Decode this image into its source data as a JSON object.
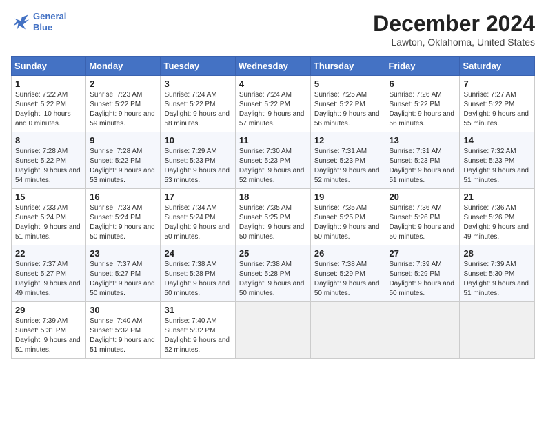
{
  "header": {
    "logo_line1": "General",
    "logo_line2": "Blue",
    "title": "December 2024",
    "subtitle": "Lawton, Oklahoma, United States"
  },
  "columns": [
    "Sunday",
    "Monday",
    "Tuesday",
    "Wednesday",
    "Thursday",
    "Friday",
    "Saturday"
  ],
  "weeks": [
    [
      {
        "day": "1",
        "sunrise": "7:22 AM",
        "sunset": "5:22 PM",
        "daylight": "10 hours and 0 minutes."
      },
      {
        "day": "2",
        "sunrise": "7:23 AM",
        "sunset": "5:22 PM",
        "daylight": "9 hours and 59 minutes."
      },
      {
        "day": "3",
        "sunrise": "7:24 AM",
        "sunset": "5:22 PM",
        "daylight": "9 hours and 58 minutes."
      },
      {
        "day": "4",
        "sunrise": "7:24 AM",
        "sunset": "5:22 PM",
        "daylight": "9 hours and 57 minutes."
      },
      {
        "day": "5",
        "sunrise": "7:25 AM",
        "sunset": "5:22 PM",
        "daylight": "9 hours and 56 minutes."
      },
      {
        "day": "6",
        "sunrise": "7:26 AM",
        "sunset": "5:22 PM",
        "daylight": "9 hours and 56 minutes."
      },
      {
        "day": "7",
        "sunrise": "7:27 AM",
        "sunset": "5:22 PM",
        "daylight": "9 hours and 55 minutes."
      }
    ],
    [
      {
        "day": "8",
        "sunrise": "7:28 AM",
        "sunset": "5:22 PM",
        "daylight": "9 hours and 54 minutes."
      },
      {
        "day": "9",
        "sunrise": "7:28 AM",
        "sunset": "5:22 PM",
        "daylight": "9 hours and 53 minutes."
      },
      {
        "day": "10",
        "sunrise": "7:29 AM",
        "sunset": "5:23 PM",
        "daylight": "9 hours and 53 minutes."
      },
      {
        "day": "11",
        "sunrise": "7:30 AM",
        "sunset": "5:23 PM",
        "daylight": "9 hours and 52 minutes."
      },
      {
        "day": "12",
        "sunrise": "7:31 AM",
        "sunset": "5:23 PM",
        "daylight": "9 hours and 52 minutes."
      },
      {
        "day": "13",
        "sunrise": "7:31 AM",
        "sunset": "5:23 PM",
        "daylight": "9 hours and 51 minutes."
      },
      {
        "day": "14",
        "sunrise": "7:32 AM",
        "sunset": "5:23 PM",
        "daylight": "9 hours and 51 minutes."
      }
    ],
    [
      {
        "day": "15",
        "sunrise": "7:33 AM",
        "sunset": "5:24 PM",
        "daylight": "9 hours and 51 minutes."
      },
      {
        "day": "16",
        "sunrise": "7:33 AM",
        "sunset": "5:24 PM",
        "daylight": "9 hours and 50 minutes."
      },
      {
        "day": "17",
        "sunrise": "7:34 AM",
        "sunset": "5:24 PM",
        "daylight": "9 hours and 50 minutes."
      },
      {
        "day": "18",
        "sunrise": "7:35 AM",
        "sunset": "5:25 PM",
        "daylight": "9 hours and 50 minutes."
      },
      {
        "day": "19",
        "sunrise": "7:35 AM",
        "sunset": "5:25 PM",
        "daylight": "9 hours and 50 minutes."
      },
      {
        "day": "20",
        "sunrise": "7:36 AM",
        "sunset": "5:26 PM",
        "daylight": "9 hours and 50 minutes."
      },
      {
        "day": "21",
        "sunrise": "7:36 AM",
        "sunset": "5:26 PM",
        "daylight": "9 hours and 49 minutes."
      }
    ],
    [
      {
        "day": "22",
        "sunrise": "7:37 AM",
        "sunset": "5:27 PM",
        "daylight": "9 hours and 49 minutes."
      },
      {
        "day": "23",
        "sunrise": "7:37 AM",
        "sunset": "5:27 PM",
        "daylight": "9 hours and 50 minutes."
      },
      {
        "day": "24",
        "sunrise": "7:38 AM",
        "sunset": "5:28 PM",
        "daylight": "9 hours and 50 minutes."
      },
      {
        "day": "25",
        "sunrise": "7:38 AM",
        "sunset": "5:28 PM",
        "daylight": "9 hours and 50 minutes."
      },
      {
        "day": "26",
        "sunrise": "7:38 AM",
        "sunset": "5:29 PM",
        "daylight": "9 hours and 50 minutes."
      },
      {
        "day": "27",
        "sunrise": "7:39 AM",
        "sunset": "5:29 PM",
        "daylight": "9 hours and 50 minutes."
      },
      {
        "day": "28",
        "sunrise": "7:39 AM",
        "sunset": "5:30 PM",
        "daylight": "9 hours and 51 minutes."
      }
    ],
    [
      {
        "day": "29",
        "sunrise": "7:39 AM",
        "sunset": "5:31 PM",
        "daylight": "9 hours and 51 minutes."
      },
      {
        "day": "30",
        "sunrise": "7:40 AM",
        "sunset": "5:32 PM",
        "daylight": "9 hours and 51 minutes."
      },
      {
        "day": "31",
        "sunrise": "7:40 AM",
        "sunset": "5:32 PM",
        "daylight": "9 hours and 52 minutes."
      },
      null,
      null,
      null,
      null
    ]
  ],
  "labels": {
    "sunrise_prefix": "Sunrise: ",
    "sunset_prefix": "Sunset: ",
    "daylight_prefix": "Daylight: "
  }
}
